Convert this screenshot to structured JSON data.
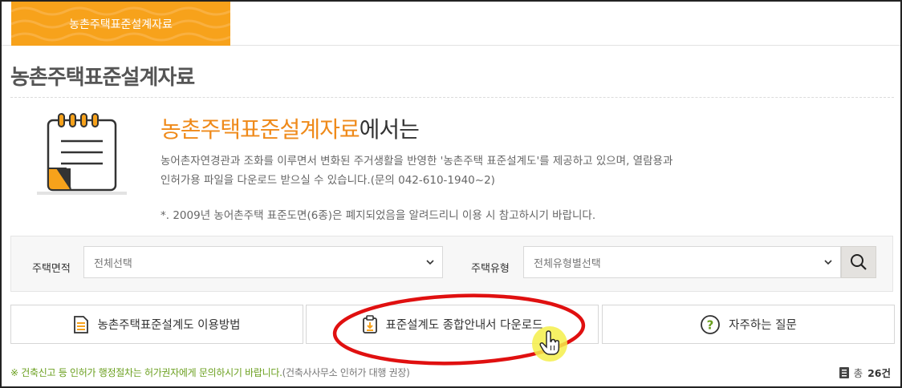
{
  "tab": {
    "label": "농촌주택표준설계자료"
  },
  "page": {
    "title": "농촌주택표준설계자료"
  },
  "intro": {
    "title_accent": "농촌주택표준설계자료",
    "title_rest": "에서는",
    "desc_line1": "농어촌자연경관과 조화를 이루면서 변화된 주거생활을 반영한 '농촌주택 표준설계도'를 제공하고 있으며, 열람용과",
    "desc_line2": "인허가용 파일을 다운로드 받으실 수 있습니다.(문의 042-610-1940~2)",
    "note": "*. 2009년 농어촌주택 표준도면(6종)은 폐지되었음을 알려드리니 이용 시 참고하시기 바랍니다."
  },
  "filters": {
    "area_label": "주택면적",
    "area_value": "전체선택",
    "type_label": "주택유형",
    "type_value": "전체유형별선택"
  },
  "actions": {
    "usage": "농촌주택표준설계도 이용방법",
    "download": "표준설계도 종합안내서 다운로드",
    "faq": "자주하는 질문"
  },
  "footer": {
    "notice": "※ 건축신고 등 인허가 행정절차는 허가권자에게 문의하시기 바랍니다.",
    "notice_sub": "(건축사사무소 인허가 대행 권장)",
    "total_prefix": "총",
    "total_count": "26건"
  },
  "colors": {
    "accent": "#f7a21b",
    "accent_text": "#ef8a1a",
    "highlight": "#e01010",
    "notice": "#6a9f1e"
  }
}
